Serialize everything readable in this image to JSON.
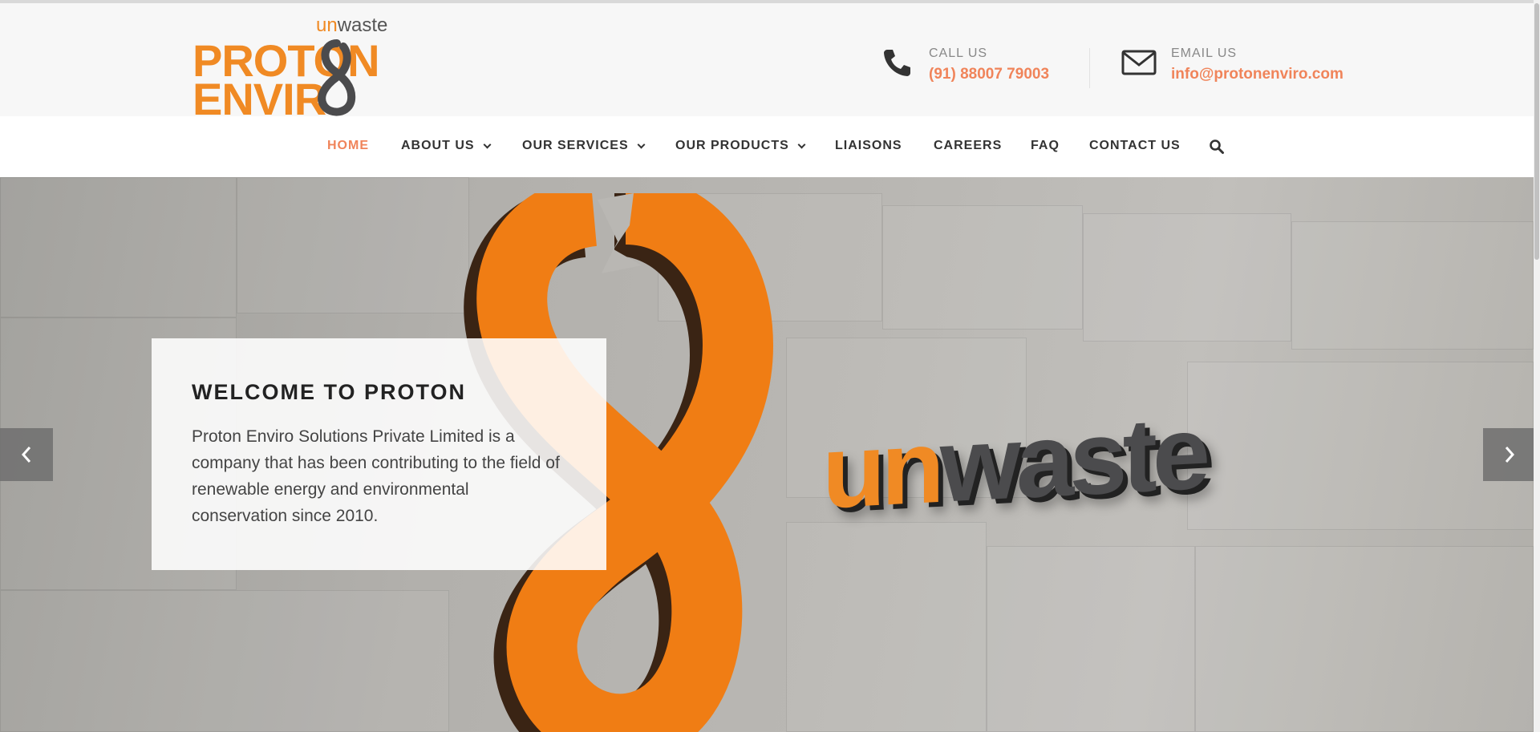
{
  "logo": {
    "line1": "PROTON",
    "line2": "ENVIR",
    "tag_un": "un",
    "tag_waste": "waste"
  },
  "contact": {
    "call_label": "CALL US",
    "call_value": "(91) 88007 79003",
    "email_label": "EMAIL US",
    "email_value": "info@protonenviro.com"
  },
  "nav": {
    "items": [
      {
        "label": "HOME",
        "active": true,
        "dropdown": false
      },
      {
        "label": "ABOUT US",
        "active": false,
        "dropdown": true
      },
      {
        "label": "OUR SERVICES",
        "active": false,
        "dropdown": true
      },
      {
        "label": "OUR PRODUCTS",
        "active": false,
        "dropdown": true
      },
      {
        "label": "LIAISONS",
        "active": false,
        "dropdown": false
      },
      {
        "label": "CAREERS",
        "active": false,
        "dropdown": false
      },
      {
        "label": "FAQ",
        "active": false,
        "dropdown": false
      },
      {
        "label": "CONTACT US",
        "active": false,
        "dropdown": false
      }
    ],
    "search_icon": "search-icon"
  },
  "hero": {
    "brand_un": "un",
    "brand_waste": "waste",
    "title": "WELCOME TO PROTON",
    "text": "Proton Enviro Solutions Private Limited is a company that has been contributing to the field of renewable energy and environmental conservation since 2010.",
    "prev_icon": "chevron-left-icon",
    "next_icon": "chevron-right-icon"
  },
  "colors": {
    "accent": "#f0845a",
    "brand_orange": "#f08a24",
    "brand_gray": "#4b4b4d"
  }
}
